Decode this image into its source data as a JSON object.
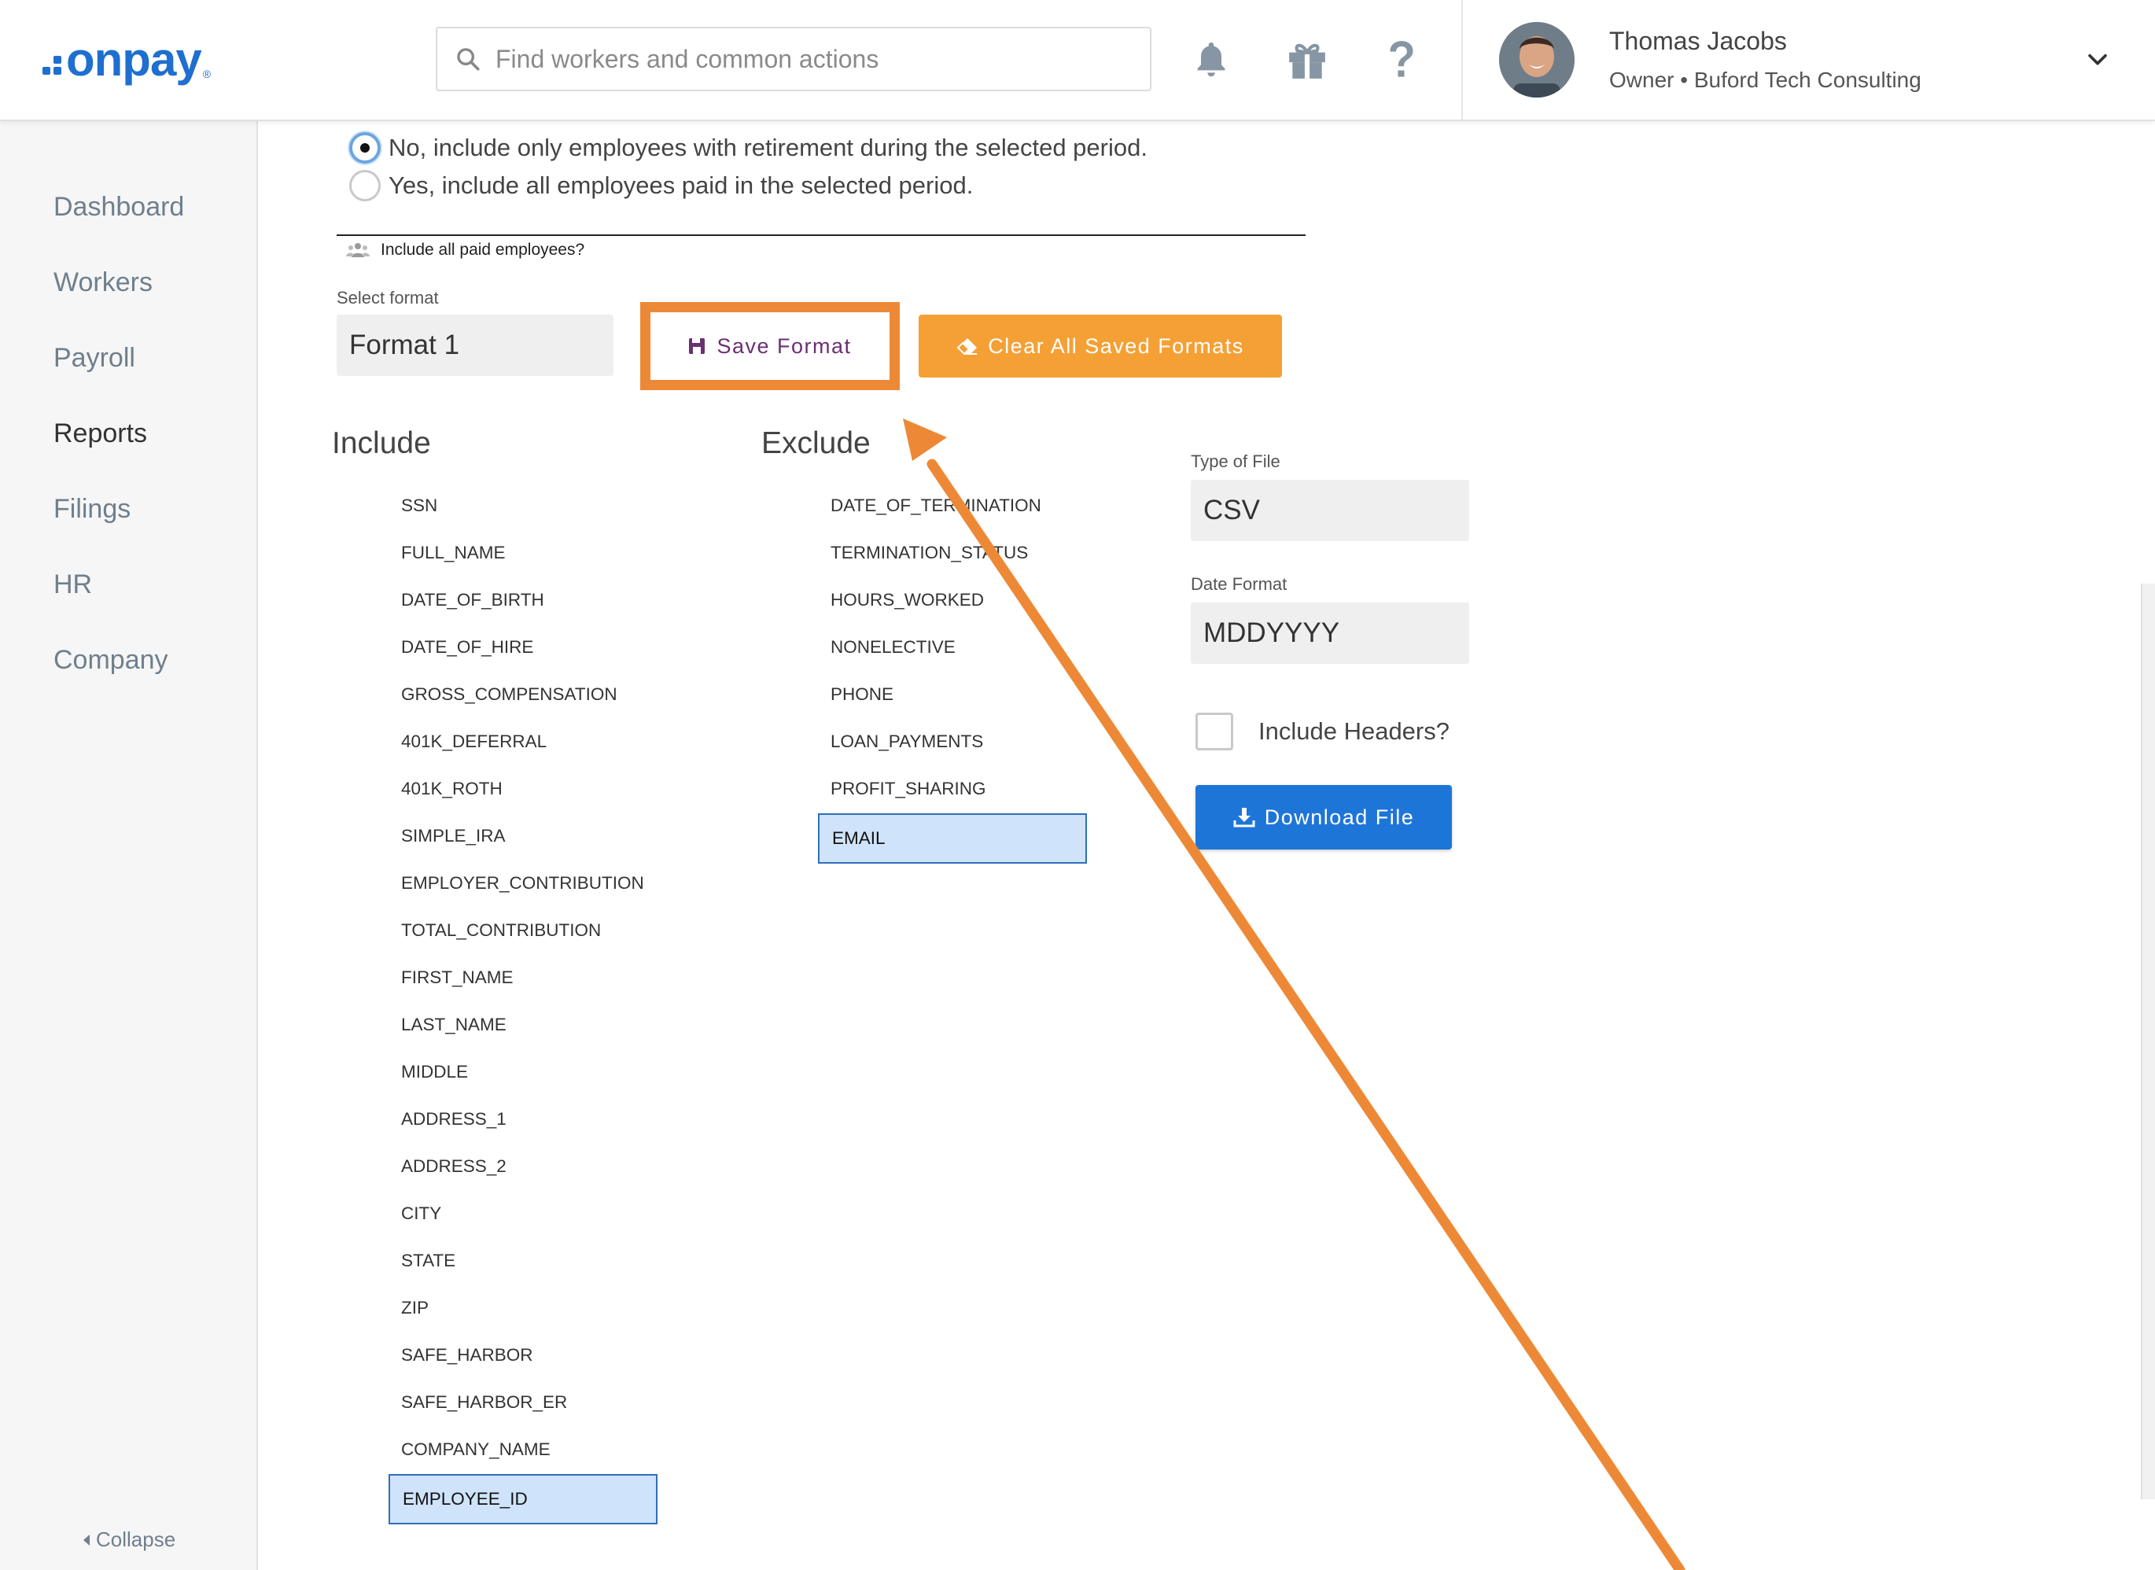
{
  "header": {
    "logo_text": "onpay",
    "logo_mark": "®",
    "search_placeholder": "Find workers and common actions",
    "icons": [
      "bell-icon",
      "gift-icon",
      "help-icon"
    ],
    "user_name": "Thomas Jacobs",
    "user_role": "Owner • Buford Tech Consulting"
  },
  "sidebar": {
    "items": [
      {
        "label": "Dashboard"
      },
      {
        "label": "Workers"
      },
      {
        "label": "Payroll"
      },
      {
        "label": "Reports",
        "active": true
      },
      {
        "label": "Filings"
      },
      {
        "label": "HR"
      },
      {
        "label": "Company"
      }
    ],
    "collapse_label": "Collapse"
  },
  "main": {
    "radio_options": [
      {
        "label": "No, include only employees with retirement during the selected period.",
        "checked": true
      },
      {
        "label": "Yes, include all employees paid in the selected period.",
        "checked": false
      }
    ],
    "legend_label": "Include all paid employees?",
    "select_format_label": "Select format",
    "select_format_value": "Format 1",
    "save_format_label": "Save Format",
    "clear_formats_label": "Clear All Saved Formats",
    "include_heading": "Include",
    "exclude_heading": "Exclude",
    "include_fields": [
      "SSN",
      "FULL_NAME",
      "DATE_OF_BIRTH",
      "DATE_OF_HIRE",
      "GROSS_COMPENSATION",
      "401K_DEFERRAL",
      "401K_ROTH",
      "SIMPLE_IRA",
      "EMPLOYER_CONTRIBUTION",
      "TOTAL_CONTRIBUTION",
      "FIRST_NAME",
      "LAST_NAME",
      "MIDDLE",
      "ADDRESS_1",
      "ADDRESS_2",
      "CITY",
      "STATE",
      "ZIP",
      "SAFE_HARBOR",
      "SAFE_HARBOR_ER",
      "COMPANY_NAME",
      "EMPLOYEE_ID"
    ],
    "include_selected": "EMPLOYEE_ID",
    "exclude_fields": [
      "DATE_OF_TERMINATION",
      "TERMINATION_STATUS",
      "HOURS_WORKED",
      "NONELECTIVE",
      "PHONE",
      "LOAN_PAYMENTS",
      "PROFIT_SHARING",
      "EMAIL"
    ],
    "exclude_selected": "EMAIL",
    "file_type_label": "Type of File",
    "file_type_value": "CSV",
    "date_format_label": "Date Format",
    "date_format_value": "MDDYYYY",
    "include_headers_label": "Include Headers?",
    "include_headers_checked": false,
    "download_label": "Download File"
  },
  "colors": {
    "brand": "#1e6fd0",
    "annotation": "#ed8936",
    "clear_button": "#f5a035",
    "download_button": "#1e75d8",
    "selected_field": "#cfe3fa"
  }
}
